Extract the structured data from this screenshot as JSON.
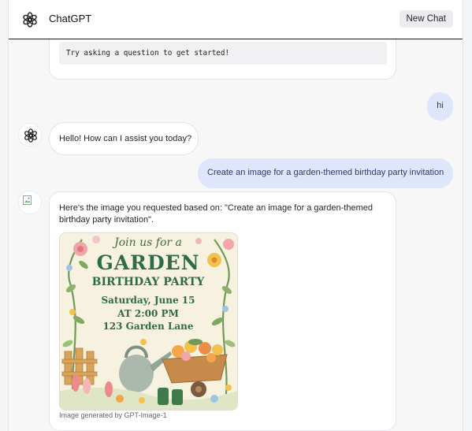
{
  "header": {
    "title": "ChatGPT",
    "new_chat_label": "New Chat"
  },
  "messages": {
    "intro_code": "Try asking a question to get started!",
    "user_1": "hi",
    "ai_1": "Hello! How can I assist you today?",
    "user_2": "Create an image for a garden-themed birthday party invitation",
    "ai_2_line1": "Here's the image you requested based on: \"Create an image for a garden-themed",
    "ai_2_line2": "birthday party invitation\".",
    "image_caption": "Image generated by GPT-Image-1"
  },
  "invitation": {
    "script_line": "Join us for a",
    "headline": "GARDEN",
    "subhead": "BIRTHDAY PARTY",
    "date_line": "Saturday, June 15",
    "time_line": "AT 2:00 PM",
    "address_line": "123 Garden Lane"
  },
  "colors": {
    "user_bubble": "#dfe6fb",
    "user_text": "#2b3a6b",
    "invite_green": "#2f6b4a",
    "invite_bg": "#f7f1df"
  },
  "icons": {
    "logo": "openai-logo-icon",
    "ai_avatar": "openai-logo-icon",
    "broken": "broken-image-icon"
  }
}
